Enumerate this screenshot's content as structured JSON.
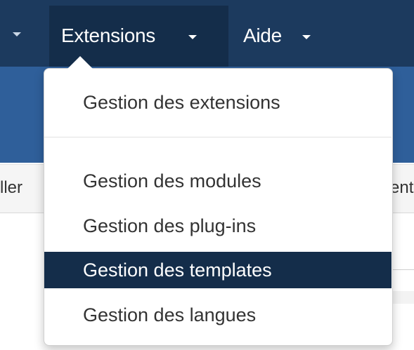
{
  "navbar": {
    "items": [
      {
        "label": "Extensions",
        "state": "open"
      },
      {
        "label": "Aide"
      }
    ]
  },
  "toolbar": {
    "fragment_left": "ller",
    "fragment_right": "ent"
  },
  "menu": {
    "items": [
      {
        "label": "Gestion des extensions"
      },
      {
        "label": "Gestion des modules"
      },
      {
        "label": "Gestion des plug-ins"
      },
      {
        "label": "Gestion des templates",
        "state": "highlighted"
      },
      {
        "label": "Gestion des langues"
      }
    ]
  },
  "colors": {
    "navbar_bg": "#1c3a5e",
    "active_bg": "#142d4a",
    "subbar_bg": "#2f5f9a",
    "menu_text": "#333333"
  }
}
